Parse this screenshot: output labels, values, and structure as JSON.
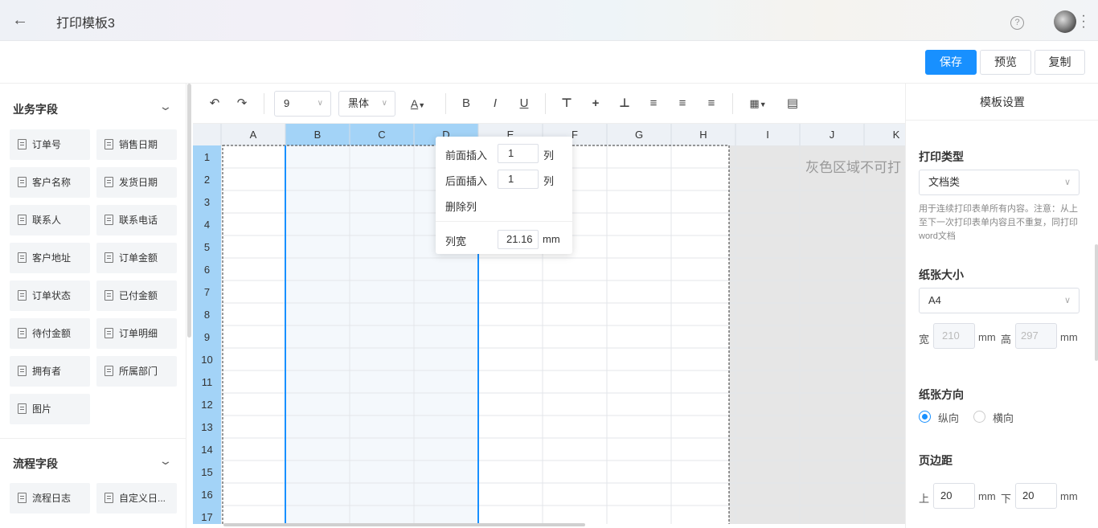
{
  "app": {
    "title": "打印模板3"
  },
  "actions": {
    "save": "保存",
    "preview": "预览",
    "copy": "复制"
  },
  "left": {
    "business_title": "业务字段",
    "business_fields": [
      "订单号",
      "销售日期",
      "客户名称",
      "发货日期",
      "联系人",
      "联系电话",
      "客户地址",
      "订单金额",
      "订单状态",
      "已付金额",
      "待付金额",
      "订单明细",
      "拥有者",
      "所属部门",
      "图片"
    ],
    "flow_title": "流程字段",
    "flow_fields": [
      "流程日志",
      "自定义日..."
    ]
  },
  "toolbar": {
    "font_size": "9",
    "font_family": "黑体",
    "font_color_glyph": "A",
    "bold": "B",
    "italic": "I",
    "underline": "U"
  },
  "grid": {
    "columns": [
      "A",
      "B",
      "C",
      "D",
      "E",
      "F",
      "G",
      "H",
      "I",
      "J",
      "K"
    ],
    "rows": [
      "1",
      "2",
      "3",
      "4",
      "5",
      "6",
      "7",
      "8",
      "9",
      "10",
      "11",
      "12",
      "13",
      "14",
      "15",
      "16",
      "17"
    ],
    "gray_notice": "灰色区域不可打"
  },
  "popup": {
    "insert_before": "前面插入",
    "insert_before_value": "1",
    "unit_col": "列",
    "insert_after": "后面插入",
    "insert_after_value": "1",
    "delete_col": "删除列",
    "col_width": "列宽",
    "col_width_value": "21.16",
    "mm": "mm"
  },
  "right": {
    "title": "模板设置",
    "print_type_label": "打印类型",
    "print_type_value": "文档类",
    "print_type_help": "用于连续打印表单所有内容。注意：从上至下一次打印表单内容且不重复，同打印word文档",
    "paper_size_label": "纸张大小",
    "paper_size_value": "A4",
    "width_label": "宽",
    "width_value": "210",
    "height_label": "高",
    "height_value": "297",
    "mm": "mm",
    "orientation_label": "纸张方向",
    "portrait": "纵向",
    "landscape": "横向",
    "margin_label": "页边距",
    "top_label": "上",
    "top_value": "20",
    "bottom_label": "下",
    "bottom_value": "20"
  },
  "colors": {
    "accent": "#1890ff",
    "selected_header": "#a3d3f7",
    "row_header": "#a3d3f7",
    "gray_area": "#e6e6e6"
  }
}
